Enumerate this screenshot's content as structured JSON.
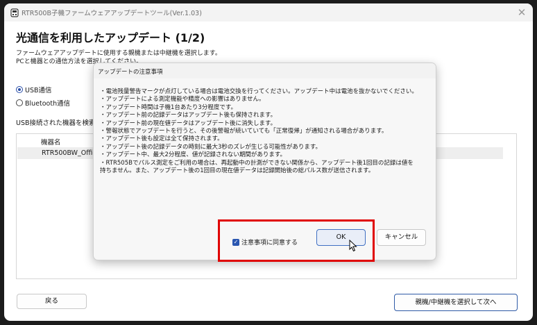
{
  "window": {
    "title": "RTR500B子機ファームウェアアップデートツール(Ver.1.03)",
    "close_glyph": "✕"
  },
  "page": {
    "heading": "光通信を利用したアップデート (1/2)",
    "description_lines": [
      "ファームウェアアップデートに使用する親機または中継機を選択します。",
      "PCと機器との通信方法を選択してください。"
    ],
    "connection_options": [
      {
        "label": "USB通信",
        "selected": true
      },
      {
        "label": "Bluetooth通信",
        "selected": false
      }
    ],
    "search_label": "USB接続された機器を検索し"
  },
  "device_table": {
    "column_header": "機器名",
    "rows": [
      {
        "name": "RTR500BW_Office"
      }
    ]
  },
  "footer": {
    "back_label": "戻る",
    "next_label": "親機/中継機を選択して次へ"
  },
  "dialog": {
    "title": "アップデートの注意事項",
    "lines": [
      "・電池残量警告マークが点灯している場合は電池交換を行ってください。アップデート中は電池を抜かないでください。",
      "・アップデートによる測定機能や精度への影響はありません。",
      "・アップデート時間は子機1台あたり3分程度です。",
      "・アップデート前の記録データはアップデート後も保持されます。",
      "・アップデート前の現在値データはアップデート後に消失します。",
      "・警報状態でアップデートを行うと、その後警報が続いていても「正常復帰」が通知される場合があります。",
      "・アップデート後も設定は全て保持されます。",
      "・アップデート後の記録データの時刻に最大3秒のズレが生じる可能性があります。",
      "・アップデート中、最大2分程度、値が記録されない期間があります。",
      "・RTR505Bでパルス測定をご利用の場合は、再起動中の計測ができない関係から、アップデート後1回目の記録は値を",
      "持ちません。また、アップデート後の1回目の現在値データは記録開始後の総パルス数が送信されます。"
    ],
    "agree_label": "注意事項に同意する",
    "agree_checked": true,
    "ok_label": "OK",
    "cancel_label": "キャンセル"
  },
  "colors": {
    "accent": "#2a56b0",
    "highlight": "#e00000"
  }
}
